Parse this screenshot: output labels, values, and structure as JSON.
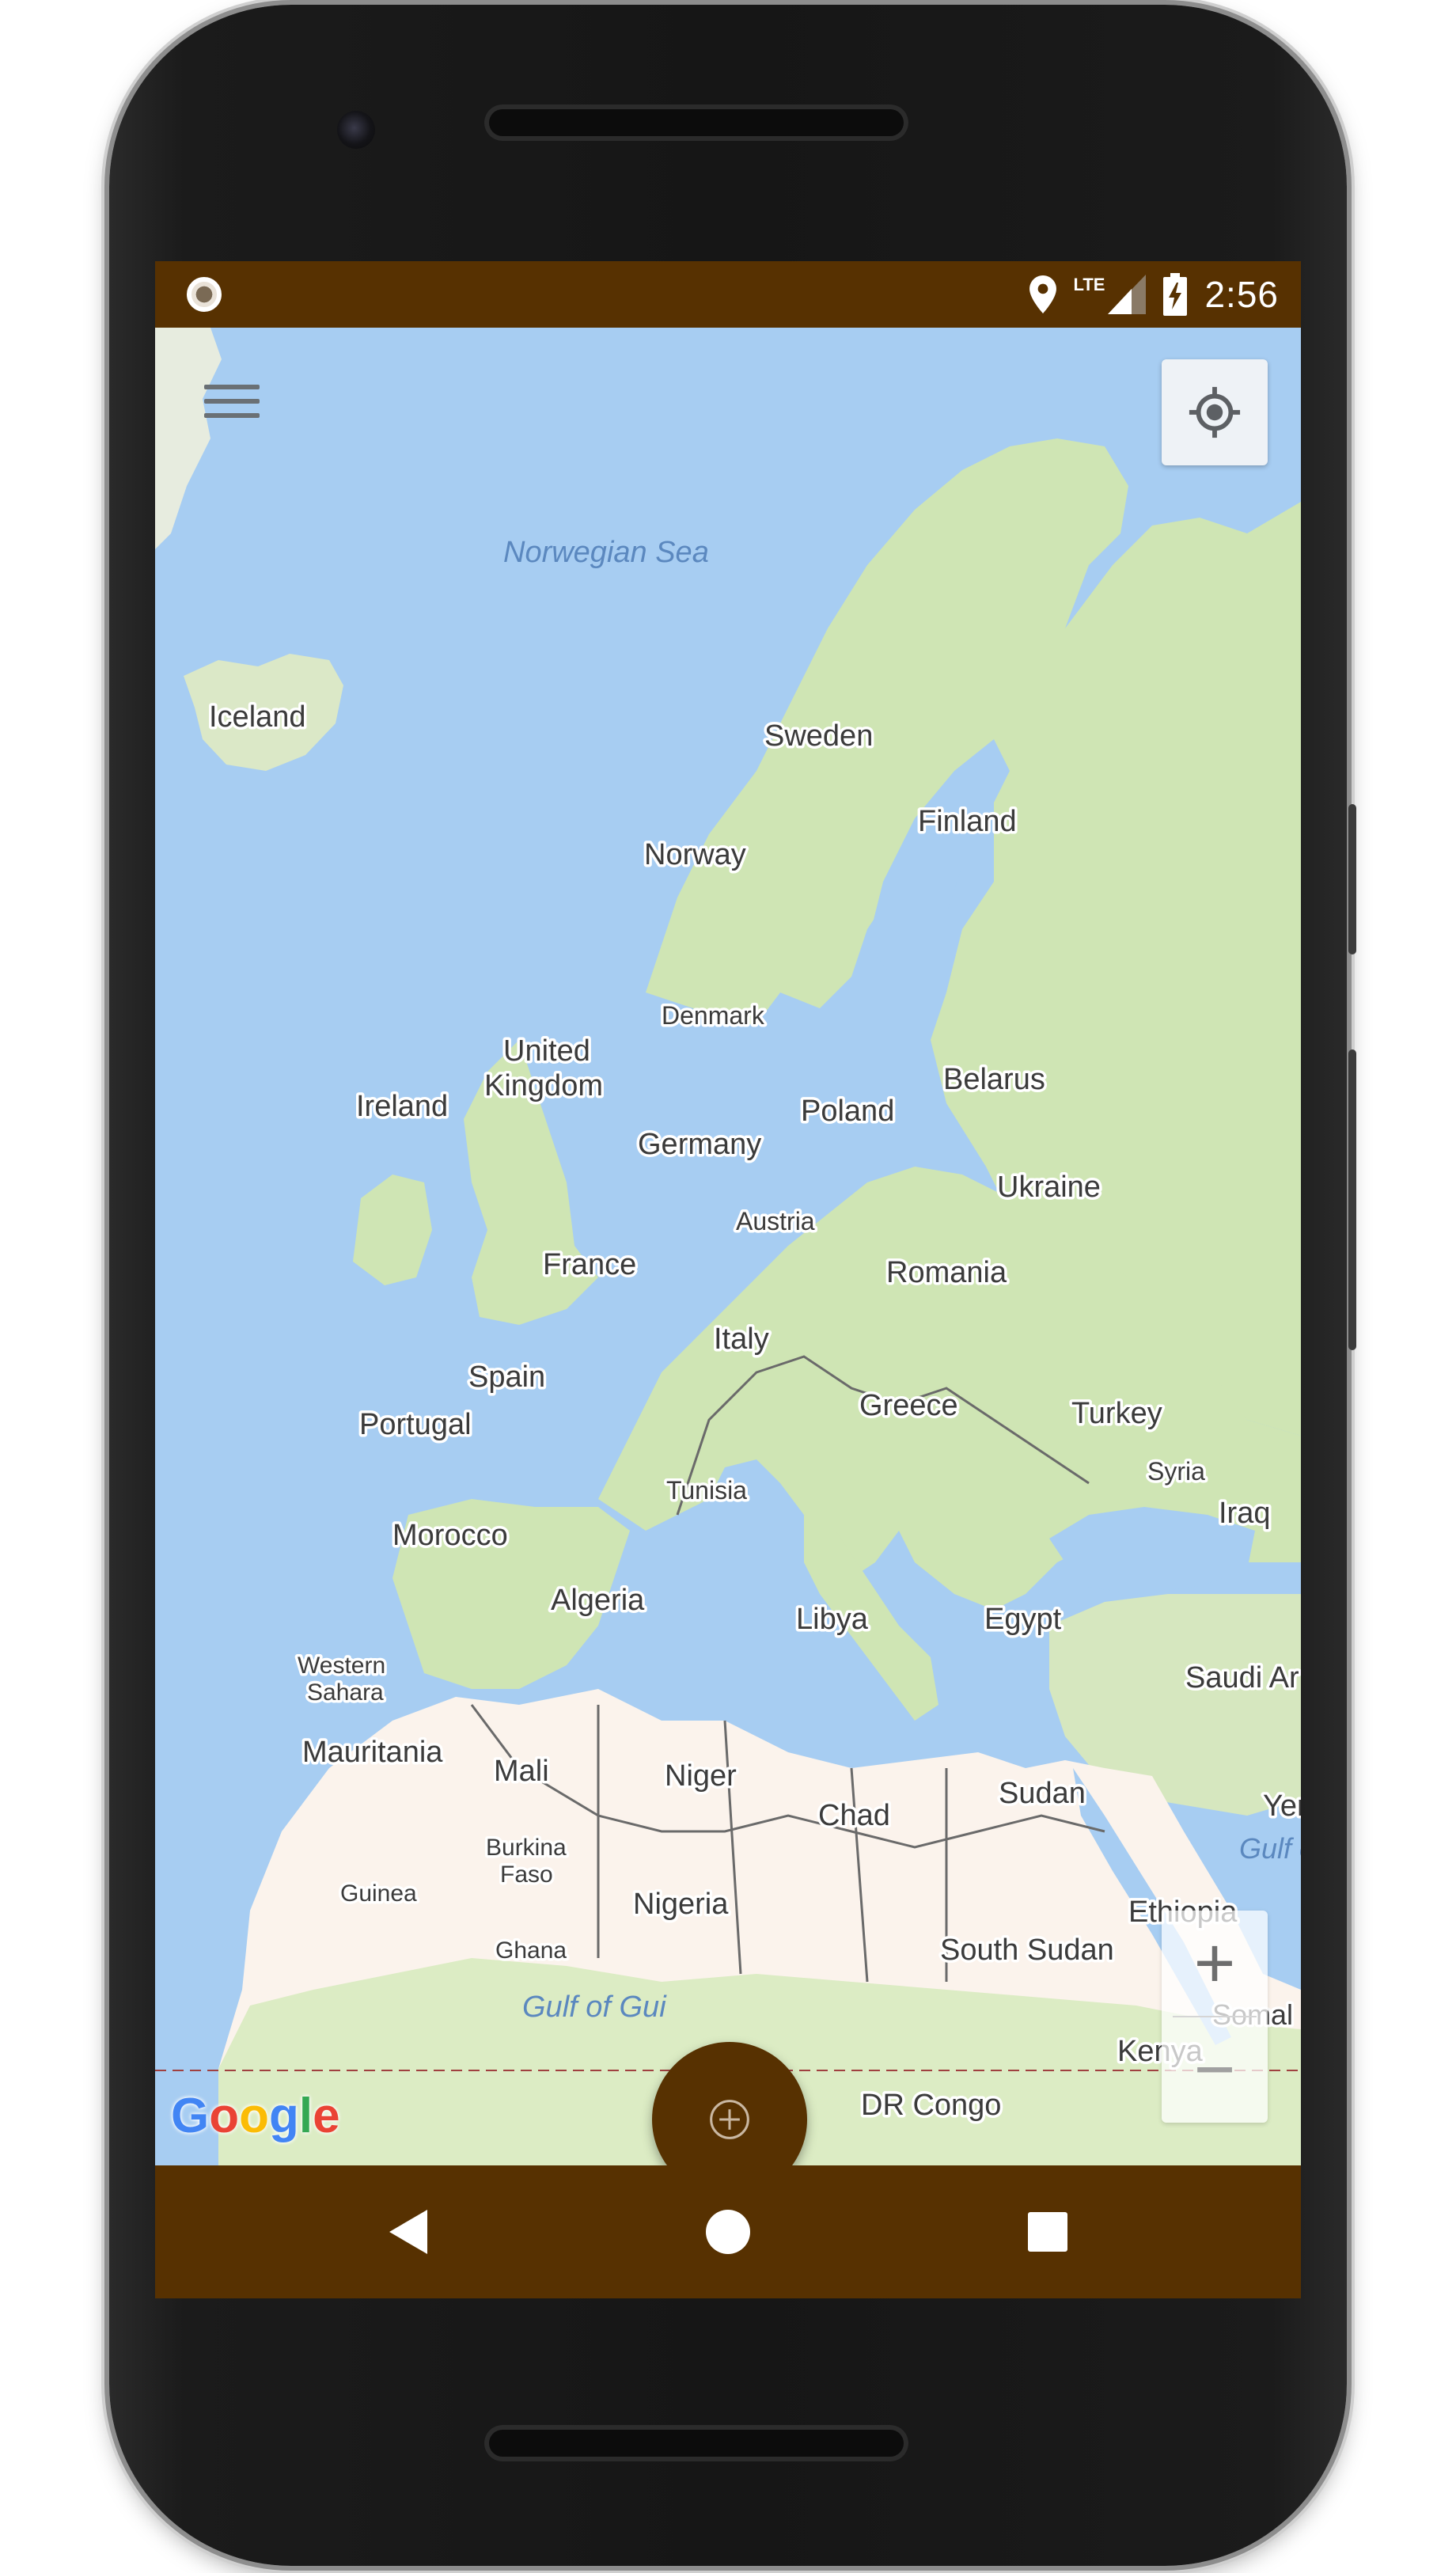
{
  "status_bar": {
    "time": "2:56",
    "network": "LTE",
    "icons": [
      "record-icon",
      "location-pin-icon",
      "signal-icon",
      "battery-charging-icon"
    ]
  },
  "map": {
    "watermark": "Google",
    "labels": {
      "norwegian_sea": "Norwegian Sea",
      "iceland": "Iceland",
      "sweden": "Sweden",
      "finland": "Finland",
      "norway": "Norway",
      "denmark": "Denmark",
      "united_kingdom_1": "United",
      "united_kingdom_2": "Kingdom",
      "ireland": "Ireland",
      "poland": "Poland",
      "belarus": "Belarus",
      "germany": "Germany",
      "ukraine": "Ukraine",
      "austria": "Austria",
      "france": "France",
      "romania": "Romania",
      "italy": "Italy",
      "spain": "Spain",
      "portugal": "Portugal",
      "greece": "Greece",
      "turkey": "Turkey",
      "tunisia": "Tunisia",
      "syria": "Syria",
      "morocco": "Morocco",
      "iraq": "Iraq",
      "algeria": "Algeria",
      "libya": "Libya",
      "egypt": "Egypt",
      "western_sahara_1": "Western",
      "western_sahara_2": "Sahara",
      "saudi_arabia": "Saudi Ar",
      "mauritania": "Mauritania",
      "mali": "Mali",
      "niger": "Niger",
      "sudan": "Sudan",
      "chad": "Chad",
      "yemen": "Yer",
      "gulf_aden": "Gulf o",
      "burkina_faso_1": "Burkina",
      "burkina_faso_2": "Faso",
      "guinea": "Guinea",
      "nigeria": "Nigeria",
      "ethiopia": "Ethiopia",
      "ghana": "Ghana",
      "south_sudan": "South Sudan",
      "gulf_guinea": "Gulf of Gui",
      "somalia": "Somal",
      "kenya": "Kenya",
      "dr_congo": "DR Congo"
    }
  },
  "controls": {
    "menu_icon": "hamburger-menu-icon",
    "locate_icon": "my-location-icon",
    "zoom_in": "+",
    "zoom_out": "−",
    "fab_icon": "add-circle-icon"
  },
  "navigation": {
    "icons": [
      "back-icon",
      "home-icon",
      "recents-icon"
    ]
  },
  "colors": {
    "app_bar": "#573101",
    "water": "#a7cdf2",
    "land_green": "#cfe5b4",
    "desert": "#fbf3ec"
  }
}
